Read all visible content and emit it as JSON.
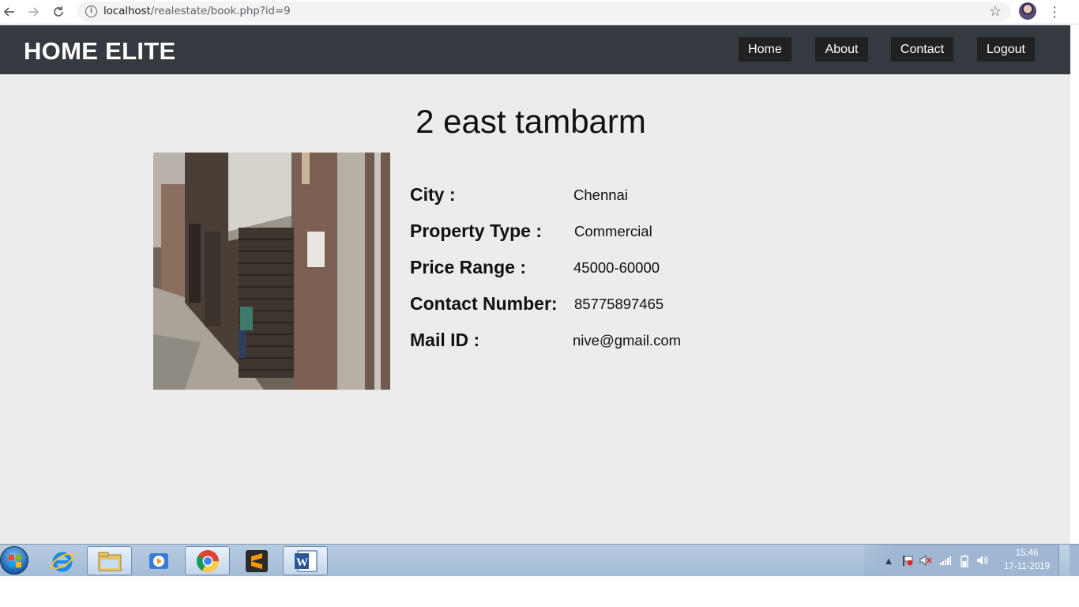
{
  "browser": {
    "url_host": "localhost",
    "url_path": "/realestate/book.php?id=9",
    "icons": [
      "back-arrow-icon",
      "forward-arrow-icon",
      "reload-icon",
      "site-info-icon",
      "bookmark-star-icon",
      "profile-avatar",
      "menu-kebab-icon"
    ]
  },
  "navbar": {
    "brand": "HOME ELITE",
    "links": [
      {
        "label": "Home"
      },
      {
        "label": "About"
      },
      {
        "label": "Contact"
      },
      {
        "label": "Logout"
      }
    ],
    "background_color": "#343a40",
    "link_background": "#212121"
  },
  "property": {
    "title": "2 east tambarm",
    "details": [
      {
        "label": "City :",
        "value": "Chennai"
      },
      {
        "label": "Property Type :",
        "value": "Commercial"
      },
      {
        "label": "Price Range :",
        "value": "45000-60000"
      },
      {
        "label": "Contact Number:",
        "value": "85775897465"
      },
      {
        "label": "Mail ID :",
        "value": "nive@gmail.com"
      }
    ]
  },
  "taskbar": {
    "apps": [
      "start-orb",
      "internet-explorer-icon",
      "file-explorer-icon",
      "media-player-icon",
      "chrome-icon",
      "sublime-text-icon",
      "word-icon"
    ],
    "clock_time": "15:46",
    "clock_date": "17-11-2019"
  }
}
